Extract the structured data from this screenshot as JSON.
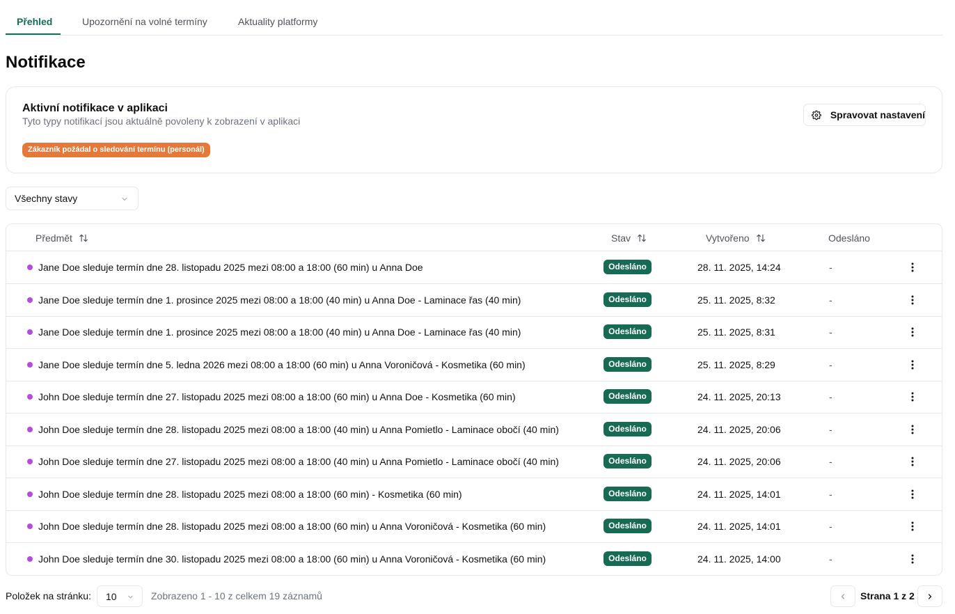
{
  "tabs": [
    {
      "label": "Přehled",
      "active": true
    },
    {
      "label": "Upozornění na volné termíny",
      "active": false
    },
    {
      "label": "Aktuality platformy",
      "active": false
    }
  ],
  "page_title": "Notifikace",
  "active_notifications": {
    "title": "Aktivní notifikace v aplikaci",
    "description": "Tyto typy notifikací jsou aktuálně povoleny k zobrazení v aplikaci",
    "badge": "Zákazník požádal o sledování termínu (personál)",
    "settings_button": "Spravovat nastavení"
  },
  "status_filter": {
    "value": "Všechny stavy"
  },
  "table": {
    "columns": {
      "subject": "Předmět",
      "status": "Stav",
      "created": "Vytvořeno",
      "sent": "Odesláno"
    },
    "rows": [
      {
        "subject": "Jane Doe sleduje termín dne 28. listopadu 2025 mezi 08:00 a 18:00 (60 min) u Anna Doe",
        "status": "Odesláno",
        "created": "28. 11. 2025, 14:24",
        "sent": "-"
      },
      {
        "subject": "Jane Doe sleduje termín dne 1. prosince 2025 mezi 08:00 a 18:00 (40 min) u Anna Doe - Laminace řas (40 min)",
        "status": "Odesláno",
        "created": "25. 11. 2025, 8:32",
        "sent": "-"
      },
      {
        "subject": "Jane Doe sleduje termín dne 1. prosince 2025 mezi 08:00 a 18:00 (40 min) u Anna Doe - Laminace řas (40 min)",
        "status": "Odesláno",
        "created": "25. 11. 2025, 8:31",
        "sent": "-"
      },
      {
        "subject": "Jane Doe sleduje termín dne 5. ledna 2026 mezi 08:00 a 18:00 (60 min) u Anna Voroničová - Kosmetika (60 min)",
        "status": "Odesláno",
        "created": "25. 11. 2025, 8:29",
        "sent": "-"
      },
      {
        "subject": "John Doe sleduje termín dne 27. listopadu 2025 mezi 08:00 a 18:00 (60 min) u Anna Doe - Kosmetika (60 min)",
        "status": "Odesláno",
        "created": "24. 11. 2025, 20:13",
        "sent": "-"
      },
      {
        "subject": "John Doe sleduje termín dne 28. listopadu 2025 mezi 08:00 a 18:00 (40 min) u Anna Pomietlo - Laminace obočí (40 min)",
        "status": "Odesláno",
        "created": "24. 11. 2025, 20:06",
        "sent": "-"
      },
      {
        "subject": "John Doe sleduje termín dne 27. listopadu 2025 mezi 08:00 a 18:00 (40 min) u Anna Pomietlo - Laminace obočí (40 min)",
        "status": "Odesláno",
        "created": "24. 11. 2025, 20:06",
        "sent": "-"
      },
      {
        "subject": "John Doe sleduje termín dne 28. listopadu 2025 mezi 08:00 a 18:00 (60 min) - Kosmetika (60 min)",
        "status": "Odesláno",
        "created": "24. 11. 2025, 14:01",
        "sent": "-"
      },
      {
        "subject": "John Doe sleduje termín dne 28. listopadu 2025 mezi 08:00 a 18:00 (60 min) u Anna Voroničová - Kosmetika (60 min)",
        "status": "Odesláno",
        "created": "24. 11. 2025, 14:01",
        "sent": "-"
      },
      {
        "subject": "John Doe sleduje termín dne 30. listopadu 2025 mezi 08:00 a 18:00 (60 min) u Anna Voroničová - Kosmetika (60 min)",
        "status": "Odesláno",
        "created": "24. 11. 2025, 14:00",
        "sent": "-"
      }
    ]
  },
  "pagination": {
    "per_page_label": "Položek na stránku:",
    "per_page": "10",
    "range_text": "Zobrazeno 1 - 10 z celkem 19 záznamů",
    "page_info": "Strana 1 z 2"
  },
  "icons": {
    "settings": "gear-icon",
    "select": "chevron-down-icon",
    "sort": "sort-icon",
    "row_actions": "more-vertical-icon",
    "prev": "chevron-left-icon",
    "next": "chevron-right-icon"
  },
  "colors": {
    "accent": "#166b57",
    "status_badge": "#176b55",
    "notification_badge": "#e5793a",
    "unread_dot": "#b54ce0"
  }
}
